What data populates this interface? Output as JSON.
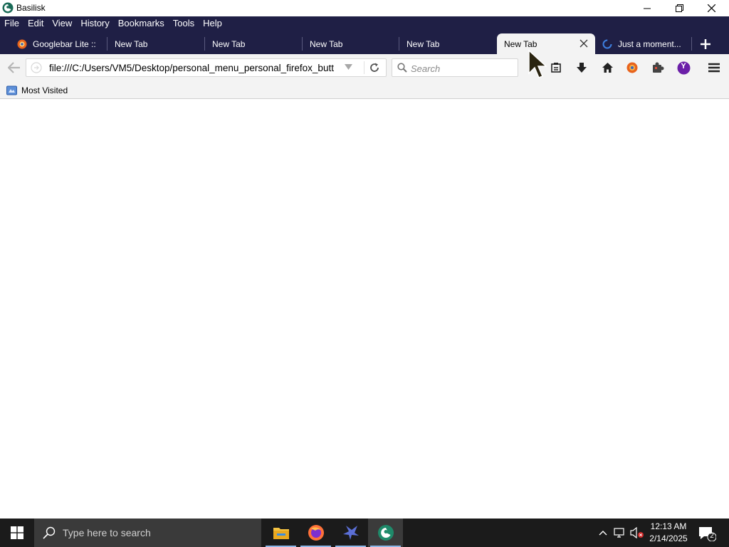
{
  "window": {
    "title": "Basilisk"
  },
  "menu": [
    "File",
    "Edit",
    "View",
    "History",
    "Bookmarks",
    "Tools",
    "Help"
  ],
  "tabs": [
    {
      "label": "Googlebar Lite ::"
    },
    {
      "label": "New Tab"
    },
    {
      "label": "New Tab"
    },
    {
      "label": "New Tab"
    },
    {
      "label": "New Tab"
    },
    {
      "label": "New Tab"
    },
    {
      "label": "Just a moment..."
    }
  ],
  "navbar": {
    "url": "file:///C:/Users/VM5/Desktop/personal_menu_personal_firefox_butt",
    "search_placeholder": "Search",
    "profile_initial": "Y"
  },
  "bookmarks": {
    "most_visited": "Most Visited"
  },
  "taskbar": {
    "search_placeholder": "Type here to search",
    "time": "12:13 AM",
    "date": "2/14/2025",
    "notification_count": "2"
  },
  "colors": {
    "chrome_dark": "#1f1f45",
    "toolbar": "#f3f3f3",
    "taskbar": "#1b1b1b"
  }
}
